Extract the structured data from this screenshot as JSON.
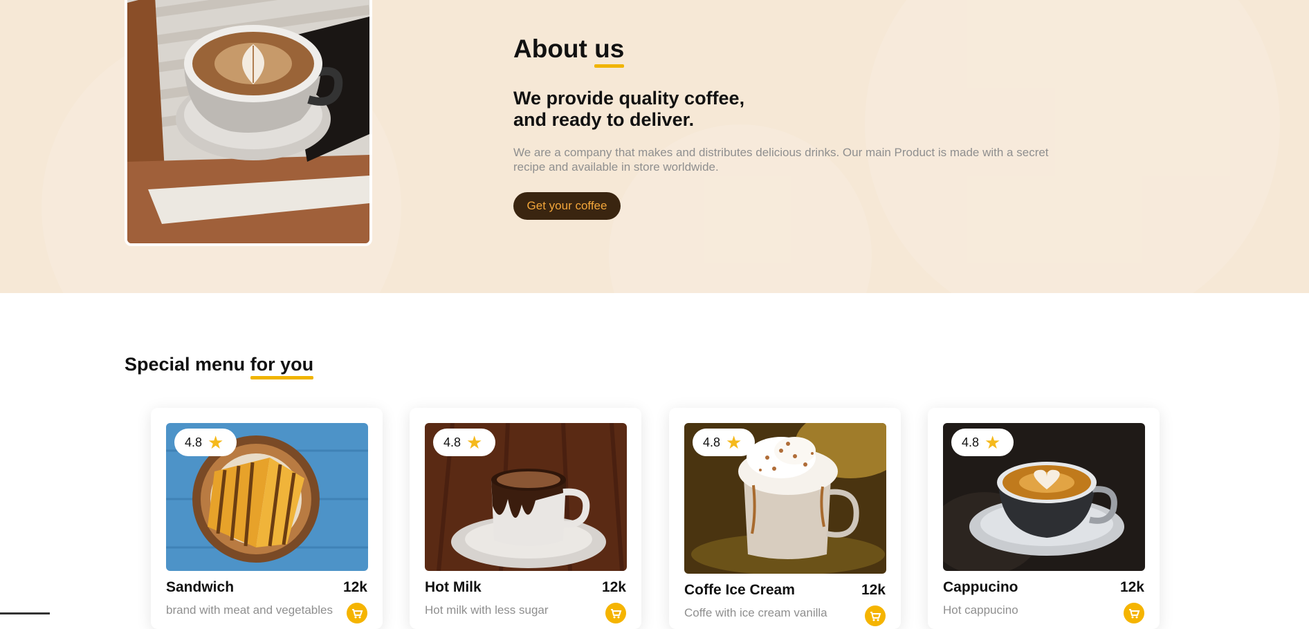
{
  "about": {
    "title_main": "About",
    "title_accent": "us",
    "subtitle_line1": "We provide quality coffee,",
    "subtitle_line2": "and ready to deliver.",
    "description": "We are a company that makes and distributes delicious drinks. Our main Product is made with a secret recipe and available in store worldwide.",
    "button_label": "Get your coffee"
  },
  "menu": {
    "title_main": "Special menu",
    "title_accent": "for you",
    "items": [
      {
        "rating": "4.8",
        "name": "Sandwich",
        "price": "12k",
        "description": "brand with meat and vegetables"
      },
      {
        "rating": "4.8",
        "name": "Hot Milk",
        "price": "12k",
        "description": "Hot milk with less sugar"
      },
      {
        "rating": "4.8",
        "name": "Coffe Ice Cream",
        "price": "12k",
        "description": "Coffe with ice cream vanilla"
      },
      {
        "rating": "4.8",
        "name": "Cappucino",
        "price": "12k",
        "description": "Hot cappucino"
      }
    ]
  },
  "colors": {
    "about_bg": "#f6e8d6",
    "accent": "#f0b400",
    "button_bg": "#3a2510",
    "button_text": "#f3a63a"
  },
  "icons": {
    "rating": "star-icon",
    "cart": "cart-icon"
  }
}
